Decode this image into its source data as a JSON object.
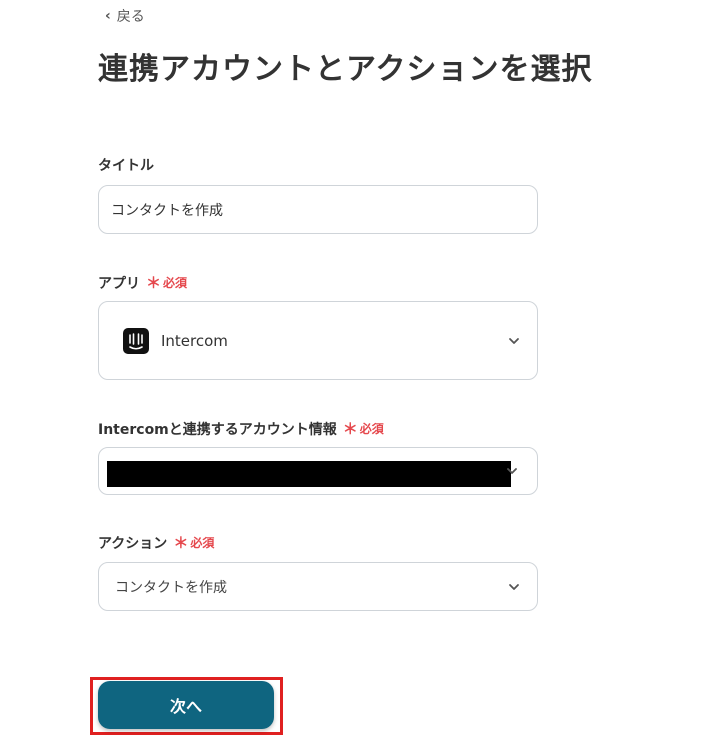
{
  "nav": {
    "back_label": "戻る"
  },
  "page_title": "連携アカウントとアクションを選択",
  "fields": {
    "title": {
      "label": "タイトル",
      "value": "コンタクトを作成"
    },
    "app": {
      "label": "アプリ",
      "required_mark": "＊",
      "required_text": "必須",
      "value": "Intercom",
      "icon": "intercom-logo-icon"
    },
    "account": {
      "label": "Intercomと連携するアカウント情報",
      "required_mark": "＊",
      "required_text": "必須"
    },
    "action": {
      "label": "アクション",
      "required_mark": "＊",
      "required_text": "必須",
      "value": "コンタクトを作成"
    }
  },
  "buttons": {
    "next_label": "次へ"
  },
  "colors": {
    "accent": "#0f6580",
    "required": "#e5484d",
    "highlight": "#e02020",
    "border": "#cfd4d9"
  }
}
